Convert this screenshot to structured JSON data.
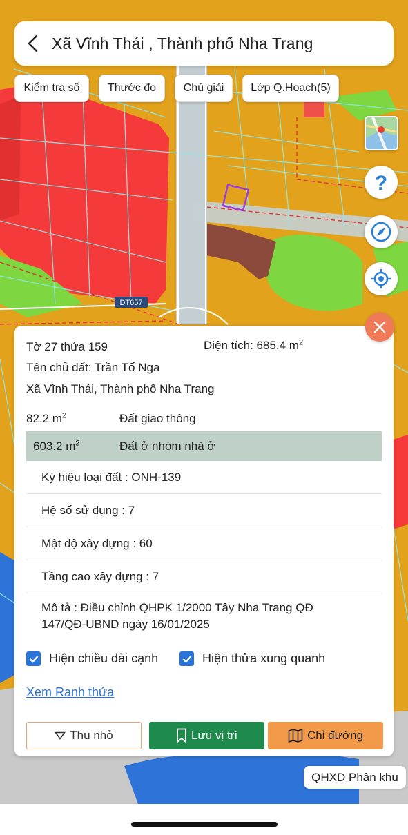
{
  "header": {
    "title": "Xã Vĩnh Thái , Thành phố Nha Trang",
    "back_icon": "chevron-left-icon"
  },
  "toolbar": {
    "chips": [
      "Kiểm tra số",
      "Thước đo",
      "Chú giải",
      "Lớp Q.Hoạch(5)"
    ]
  },
  "map": {
    "road_label": "DT657",
    "colors": {
      "residential_red": "#f43a3a",
      "planning_orange": "#e3a21c",
      "green_park": "#7ed640",
      "brown_parcel": "#8c4a3c",
      "water_blue": "#2e73d8",
      "parcel_outline": "#9b3ddb"
    }
  },
  "fabs": [
    "help-icon",
    "compass-icon",
    "locate-icon"
  ],
  "parcel": {
    "sheet_text": "Tờ 27 thửa 159",
    "area_label": "Diện tích: 685.4 m",
    "area_sup": "2",
    "owner": "Tên chủ đất: Trần Tố Nga",
    "address": "Xã Vĩnh Thái, Thành phố Nha Trang",
    "land_uses": [
      {
        "area": "82.2 m",
        "sup": "2",
        "type": "Đất giao thông"
      },
      {
        "area": "603.2 m",
        "sup": "2",
        "type": "Đất ở nhóm nhà ở"
      }
    ],
    "attributes": {
      "code": "Ký hiệu loại đất : ONH-139",
      "usage_ratio": "Hệ số sử dụng : 7",
      "density": "Mật độ xây dựng : 60",
      "floors": "Tầng cao xây dựng : 7",
      "description_1": "Mô tả : Điều chỉnh QHPK 1/2000 Tây Nha Trang QĐ",
      "description_2": "147/QĐ-UBND ngày 16/01/2025"
    },
    "checkboxes": {
      "edge_lengths": "Hiện chiều dài cạnh",
      "nearby_parcels": "Hiện thửa xung quanh"
    },
    "link": "Xem Ranh thửa",
    "buttons": {
      "minimize": "Thu nhỏ",
      "save": "Lưu vị trí",
      "directions": "Chỉ đường"
    }
  },
  "zone_label": "QHXD Phân khu"
}
